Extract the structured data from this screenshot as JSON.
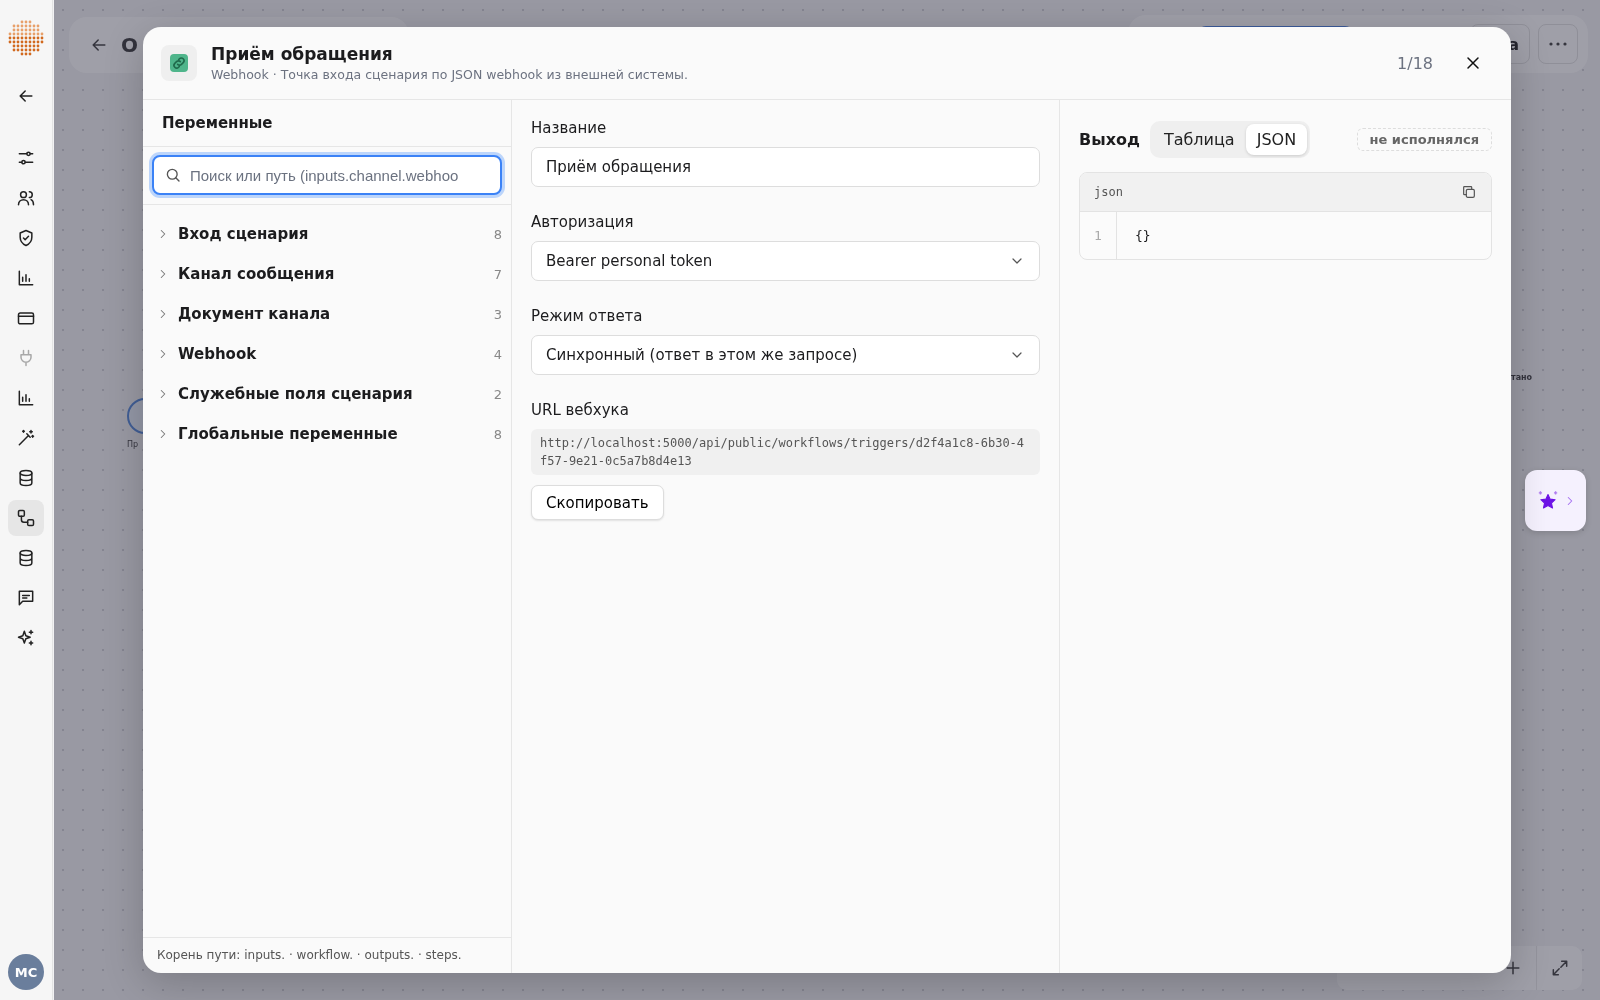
{
  "sidebar": {
    "items": [
      {
        "kind": "back",
        "selected": false,
        "disabled": false
      },
      {
        "kind": "sliders",
        "selected": false,
        "disabled": false
      },
      {
        "kind": "users",
        "selected": false,
        "disabled": false
      },
      {
        "kind": "shield",
        "selected": false,
        "disabled": false
      },
      {
        "kind": "chart",
        "selected": false,
        "disabled": false
      },
      {
        "kind": "card",
        "selected": false,
        "disabled": false
      },
      {
        "kind": "plug",
        "selected": false,
        "disabled": true
      },
      {
        "kind": "chart",
        "selected": false,
        "disabled": false
      },
      {
        "kind": "wand",
        "selected": false,
        "disabled": false
      },
      {
        "kind": "database",
        "selected": false,
        "disabled": false
      },
      {
        "kind": "workflow",
        "selected": true,
        "disabled": false
      },
      {
        "kind": "database",
        "selected": false,
        "disabled": false
      },
      {
        "kind": "message",
        "selected": false,
        "disabled": false
      },
      {
        "kind": "sparkles",
        "selected": false,
        "disabled": false
      }
    ],
    "avatar": {
      "initials": "MC"
    }
  },
  "topbar": {
    "title": "О",
    "button": "а"
  },
  "canvas": {
    "node_label": "Пр",
    "edge_label": "тано"
  },
  "modal": {
    "title": "Приём обращения",
    "subtitle": "Webhook · Точка входа сценария по JSON webhook из внешней системы.",
    "counter": "1/18",
    "variables": {
      "heading": "Переменные",
      "search": {
        "placeholder": "Поиск или путь (inputs.channel.webhoo"
      },
      "groups": [
        {
          "label": "Вход сценария",
          "count": "8",
          "expanded": false
        },
        {
          "label": "Канал сообщения",
          "count": "7",
          "expanded": false
        },
        {
          "label": "Документ канала",
          "count": "3",
          "expanded": false
        },
        {
          "label": "Webhook",
          "count": "4",
          "expanded": false
        },
        {
          "label": "Служебные поля сценария",
          "count": "2",
          "expanded": false
        },
        {
          "label": "Глобальные переменные",
          "count": "8",
          "expanded": false
        }
      ],
      "footer": "Корень пути: inputs. · workflow. · outputs. · steps."
    },
    "settings": {
      "fields": [
        {
          "kind": "input",
          "label": "Название",
          "value": "Приём обращения"
        },
        {
          "kind": "select",
          "label": "Авторизация",
          "value": "Bearer personal token"
        },
        {
          "kind": "select",
          "label": "Режим ответа",
          "value": "Синхронный (ответ в этом же запросе)"
        },
        {
          "kind": "url",
          "label": "URL вебхука",
          "value": "http://localhost:5000/api/public/workflows/triggers/d2f4a1c8-6b30-4f57-9e21-0c5a7b8d4e13",
          "button": "Скопировать"
        }
      ]
    },
    "output": {
      "label": "Выход",
      "tabs": [
        {
          "label": "Таблица",
          "selected": false
        },
        {
          "label": "JSON",
          "selected": true
        }
      ],
      "status": "не исполнялся",
      "code": {
        "language": "json",
        "lines": [
          {
            "number": "1",
            "text": "{}"
          }
        ]
      }
    }
  }
}
